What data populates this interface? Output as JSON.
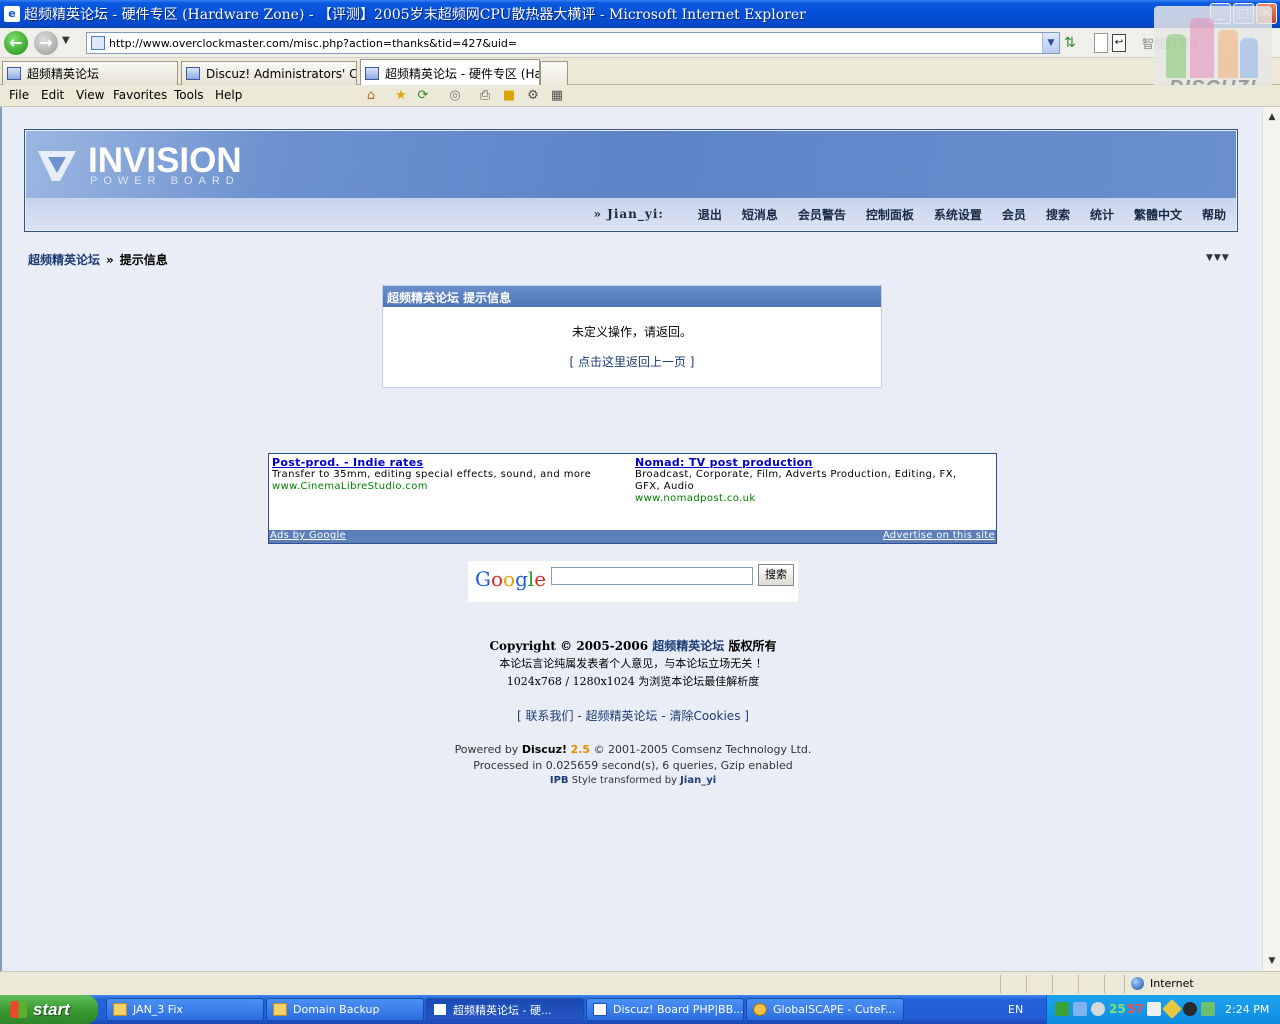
{
  "window": {
    "title": "超频精英论坛 - 硬件专区 (Hardware Zone) - 【评测】2005岁末超频网CPU散热器大横评 - Microsoft Internet Explorer",
    "minimize": "_",
    "maximize": "□",
    "close": "✕"
  },
  "address": {
    "url": "http://www.overclockmaster.com/misc.php?action=thanks&tid=427&uid="
  },
  "search_toolbar": {
    "text": "智能拼音II"
  },
  "discuz_badge": {
    "text": "DISCUZ!"
  },
  "tabs": [
    {
      "label": "超频精英论坛"
    },
    {
      "label": "Discuz! Administrators' Control Panel"
    },
    {
      "label": "超频精英论坛 - 硬件专区 (Hardware Zone)"
    }
  ],
  "menu": {
    "file": "File",
    "edit": "Edit",
    "view": "View",
    "favorites": "Favorites",
    "tools": "Tools",
    "help": "Help"
  },
  "header": {
    "logo_main": "INVISION",
    "logo_sub": "POWER BOARD",
    "user": "» Jian_yi:",
    "links": [
      "退出",
      "短消息",
      "会员警告",
      "控制面板",
      "系统设置",
      "会员",
      "搜索",
      "统计",
      "繁體中文",
      "帮助"
    ]
  },
  "breadcrumb": {
    "home": "超频精英论坛",
    "sep": "»",
    "current": "提示信息"
  },
  "message": {
    "title": "超频精英论坛 提示信息",
    "text": "未定义操作，请返回。",
    "link": "[ 点击这里返回上一页 ]"
  },
  "ads": {
    "items": [
      {
        "title": "Post-prod. - Indie rates",
        "body": "Transfer to 35mm, editing special effects, sound, and more",
        "url": "www.CinemaLibreStudio.com"
      },
      {
        "title": "Nomad: TV post production",
        "body": "Broadcast, Corporate, Film, Adverts Production, Editing, FX, GFX, Audio",
        "url": "www.nomadpost.co.uk"
      }
    ],
    "ads_by": "Ads by Google",
    "advertise": "Advertise on this site"
  },
  "google": {
    "button": "搜索"
  },
  "footer": {
    "copyright_pre": "Copyright © 2005-2006",
    "forum_name": "超频精英论坛",
    "copyright_post": "版权所有",
    "disclaimer": "本论坛言论纯属发表者个人意见，与本论坛立场无关 ！",
    "resolution": "1024x768 / 1280x1024 为浏览本论坛最佳解析度",
    "links": "[ 联系我们 - 超频精英论坛 - 清除Cookies ]",
    "powered_pre": "Powered by",
    "powered_name": "Discuz!",
    "powered_ver": "2.5",
    "powered_post": "© 2001-2005 Comsenz Technology Ltd.",
    "processed": "Processed in 0.025659 second(s), 6 queries, Gzip enabled",
    "style_pre": "IPB",
    "style_mid": "Style transformed by",
    "style_author": "Jian_yi"
  },
  "status": {
    "zone": "Internet"
  },
  "taskbar": {
    "start": "start",
    "tasks": [
      {
        "label": "JAN_3 Fix",
        "icon": "folder-icon"
      },
      {
        "label": "Domain Backup",
        "icon": "folder-icon"
      },
      {
        "label": "超频精英论坛 - 硬...",
        "icon": "ie-icon"
      },
      {
        "label": "Discuz! Board PHP|BB...",
        "icon": "ie-icon"
      },
      {
        "label": "GlobalSCAPE - CuteF...",
        "icon": "ftp-icon"
      }
    ],
    "lang": "EN",
    "tray_num1": "25",
    "tray_num2": "57",
    "clock": "2:24 PM"
  }
}
